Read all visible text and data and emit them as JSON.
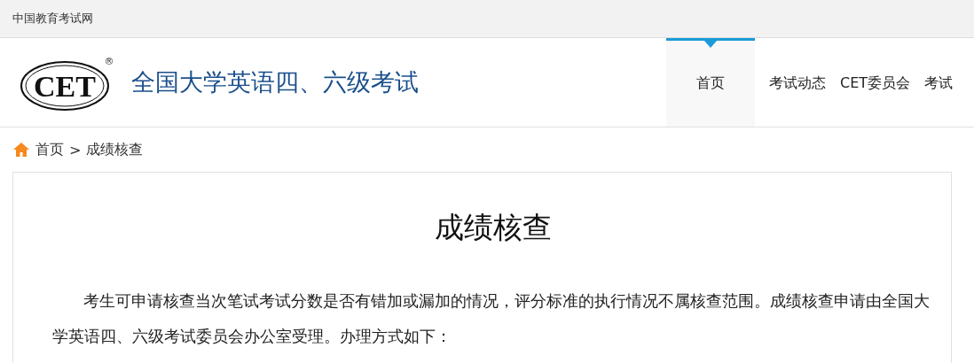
{
  "top_bar": {
    "site_name": "中国教育考试网"
  },
  "header": {
    "logo": {
      "text": "CET",
      "mark": "®"
    },
    "title": "全国大学英语四、六级考试"
  },
  "nav": [
    {
      "label": "首页",
      "selected": true
    },
    {
      "label": "考试动态",
      "selected": false
    },
    {
      "label": "CET委员会",
      "selected": false
    },
    {
      "label": "考试",
      "selected": false
    }
  ],
  "breadcrumb": {
    "home": "首页",
    "separator": ">",
    "current": "成绩核查"
  },
  "article": {
    "title": "成绩核查",
    "paragraphs": [
      "考生可申请核查当次笔试考试分数是否有错加或漏加的情况，评分标准的执行情况不属核查范围。成绩核查申请由全国大学英语四、六级考试委员会办公室受理。办理方式如下："
    ]
  }
}
